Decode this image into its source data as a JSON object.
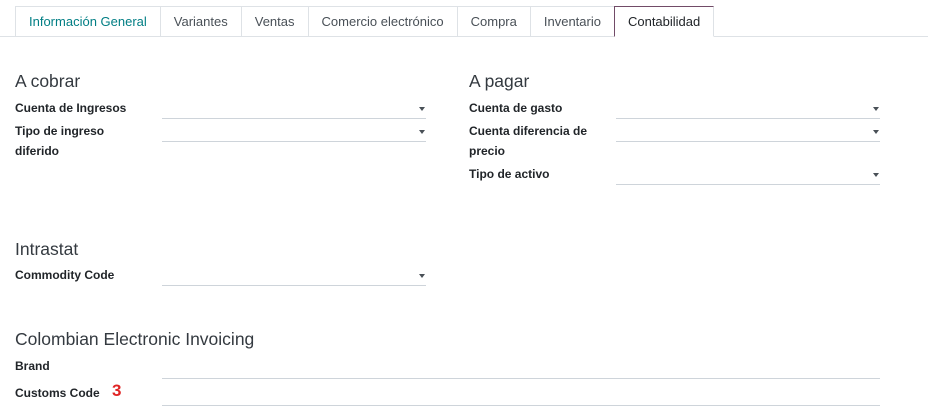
{
  "tabs": [
    {
      "label": "Información General"
    },
    {
      "label": "Variantes"
    },
    {
      "label": "Ventas"
    },
    {
      "label": "Comercio electrónico"
    },
    {
      "label": "Compra"
    },
    {
      "label": "Inventario"
    },
    {
      "label": "Contabilidad",
      "active": true
    }
  ],
  "receivable": {
    "title": "A cobrar",
    "income_account_label": "Cuenta de Ingresos",
    "deferred_income_label_1": "Tipo de ingreso",
    "deferred_income_label_2": "diferido"
  },
  "payable": {
    "title": "A pagar",
    "expense_account_label": "Cuenta de gasto",
    "price_diff_label_1": "Cuenta diferencia de",
    "price_diff_label_2": "precio",
    "asset_type_label": "Tipo de activo"
  },
  "intrastat": {
    "title": "Intrastat",
    "commodity_code_label": "Commodity Code"
  },
  "colombian": {
    "title": "Colombian Electronic Invoicing",
    "brand_label": "Brand",
    "customs_code_label": "Customs Code"
  },
  "annotation": "3",
  "colors": {
    "accent": "#714b67",
    "link": "#017e84",
    "annotation": "#e02424"
  }
}
